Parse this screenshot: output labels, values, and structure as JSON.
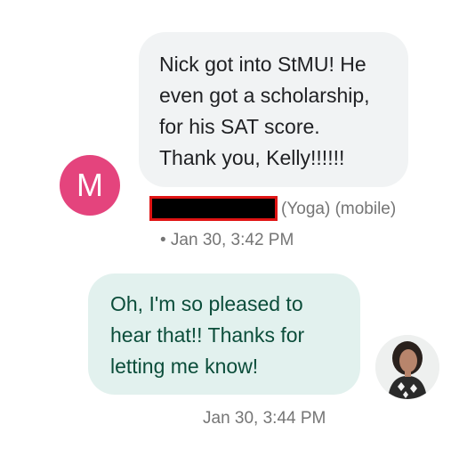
{
  "conversation": {
    "incoming": {
      "avatar_letter": "M",
      "message": "Nick got into StMU! He\neven got a scholarship,\nfor his SAT score.\nThank you, Kelly!!!!!!",
      "sender_tags": "(Yoga) (mobile)",
      "timestamp": "• Jan 30, 3:42 PM"
    },
    "outgoing": {
      "message": "Oh, I'm so pleased to\nhear that!! Thanks for\nletting me know!",
      "timestamp": "Jan 30, 3:44 PM"
    }
  },
  "colors": {
    "incoming_bubble": "#f1f3f4",
    "outgoing_bubble": "#e2f1ee",
    "outgoing_text": "#0b4d3a",
    "avatar": "#e4447d",
    "redaction_border": "#e01414"
  }
}
